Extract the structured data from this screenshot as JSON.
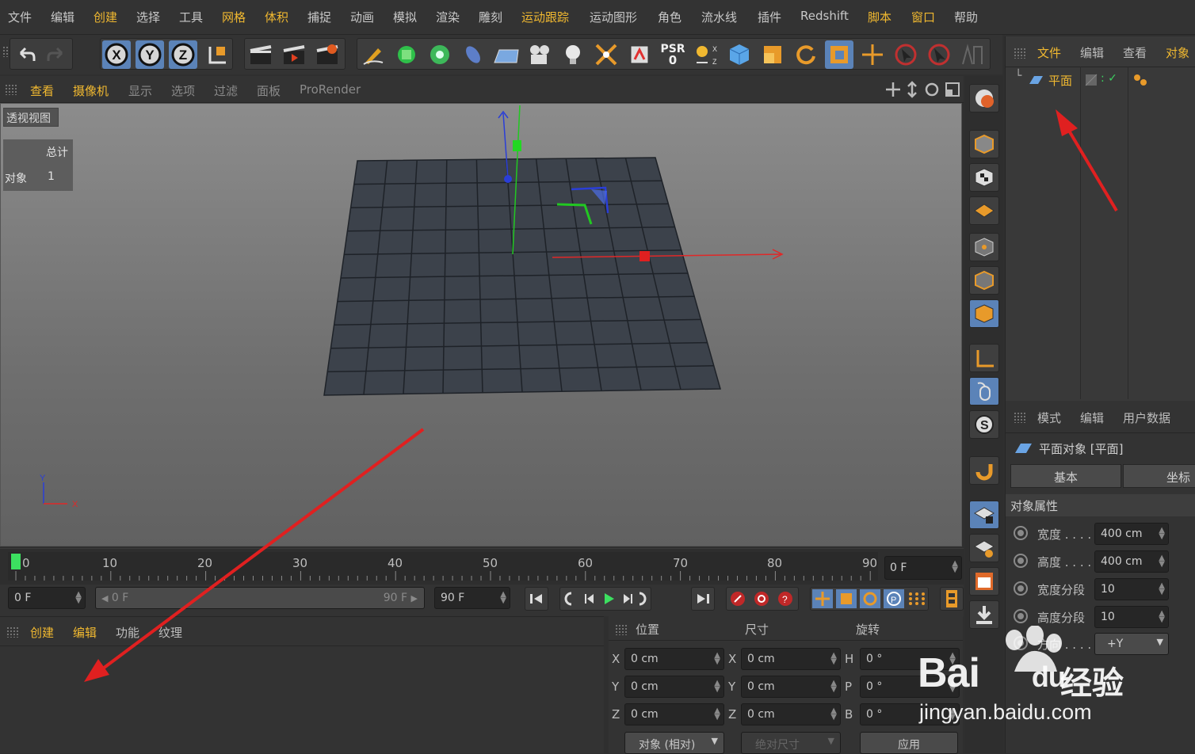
{
  "menubar": {
    "items": [
      {
        "label": "文件",
        "hl": false
      },
      {
        "label": "编辑",
        "hl": false
      },
      {
        "label": "创建",
        "hl": true
      },
      {
        "label": "选择",
        "hl": false
      },
      {
        "label": "工具",
        "hl": false
      },
      {
        "label": "网格",
        "hl": true
      },
      {
        "label": "体积",
        "hl": true
      },
      {
        "label": "捕捉",
        "hl": false
      },
      {
        "label": "动画",
        "hl": false
      },
      {
        "label": "模拟",
        "hl": false
      },
      {
        "label": "渲染",
        "hl": false
      },
      {
        "label": "雕刻",
        "hl": false
      },
      {
        "label": "运动跟踪",
        "hl": true
      },
      {
        "label": "运动图形",
        "hl": false
      },
      {
        "label": "角色",
        "hl": false
      },
      {
        "label": "流水线",
        "hl": false
      },
      {
        "label": "插件",
        "hl": false
      },
      {
        "label": "Redshift",
        "hl": false
      },
      {
        "label": "脚本",
        "hl": true
      },
      {
        "label": "窗口",
        "hl": true
      },
      {
        "label": "帮助",
        "hl": false
      }
    ]
  },
  "toolbar": {
    "axis_x": "X",
    "axis_y": "Y",
    "axis_z": "Z",
    "psr_label": "PSR",
    "psr_value": "0"
  },
  "viewport": {
    "menus": [
      {
        "label": "查看",
        "hl": true
      },
      {
        "label": "摄像机",
        "hl": true
      },
      {
        "label": "显示",
        "hl": false
      },
      {
        "label": "选项",
        "hl": false
      },
      {
        "label": "过滤",
        "hl": false
      },
      {
        "label": "面板",
        "hl": false
      },
      {
        "label": "ProRender",
        "hl": false
      }
    ],
    "view_name": "透视视图",
    "hud_total_label": "总计",
    "hud_objects_label": "对象",
    "hud_objects_value": "1",
    "axis_y": "Y",
    "axis_x": "X"
  },
  "timeline": {
    "ticks": [
      "0",
      "10",
      "20",
      "30",
      "40",
      "50",
      "60",
      "70",
      "80",
      "90"
    ],
    "current_frame": "0 F"
  },
  "transport": {
    "start_field": "0 F",
    "range_start": "0 F",
    "range_end": "90 F",
    "end_field": "90 F"
  },
  "material_panel": {
    "menus": [
      {
        "label": "创建",
        "hl": true
      },
      {
        "label": "编辑",
        "hl": true
      },
      {
        "label": "功能",
        "hl": false
      },
      {
        "label": "纹理",
        "hl": false
      }
    ]
  },
  "coordinates": {
    "headers": {
      "position": "位置",
      "size": "尺寸",
      "rotation": "旋转"
    },
    "rows": [
      {
        "axis": "X",
        "pos": "0 cm",
        "size_axis": "X",
        "size": "0 cm",
        "rot_axis": "H",
        "rot": "0 °"
      },
      {
        "axis": "Y",
        "pos": "0 cm",
        "size_axis": "Y",
        "size": "0 cm",
        "rot_axis": "P",
        "rot": "0 °"
      },
      {
        "axis": "Z",
        "pos": "0 cm",
        "size_axis": "Z",
        "size": "0 cm",
        "rot_axis": "B",
        "rot": "0 °"
      }
    ],
    "mode_select": "对象 (相对)",
    "size_select": "绝对尺寸",
    "apply_button": "应用"
  },
  "object_manager": {
    "menus": [
      "文件",
      "编辑",
      "查看",
      "对象"
    ],
    "object_name": "平面"
  },
  "attribute_manager": {
    "menus": [
      "模式",
      "编辑",
      "用户数据"
    ],
    "object_title": "平面对象 [平面]",
    "tab_basic": "基本",
    "tab_coord": "坐标",
    "section": "对象属性",
    "props": [
      {
        "label": "宽度 . . . .",
        "value": "400 cm"
      },
      {
        "label": "高度 . . . .",
        "value": "400 cm"
      },
      {
        "label": "宽度分段",
        "value": "10"
      },
      {
        "label": "高度分段",
        "value": "10"
      }
    ],
    "orientation_label": "方向 . . . .",
    "orientation_value": "+Y"
  },
  "watermark": {
    "brand": "Bai",
    "brand2": "du",
    "suffix": "经验",
    "url": "jingyan.baidu.com"
  },
  "colors": {
    "accent": "#f0b830",
    "active_button": "#5b83b8",
    "annotation_arrow": "#e02020",
    "x_axis": "#e02828",
    "y_axis": "#22c822",
    "z_axis": "#2a3ed8"
  }
}
